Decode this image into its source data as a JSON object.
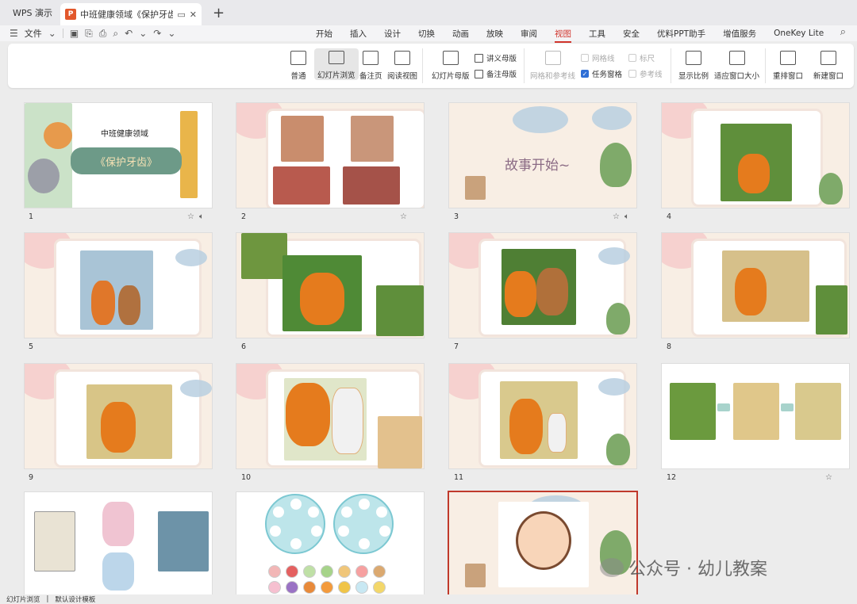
{
  "titlebar": {
    "app_label": "WPS 演示",
    "doc_tab_logo": "P",
    "doc_tab_title": "中班健康领域《保护牙齿》课",
    "new_tab_symbol": "+"
  },
  "menu": {
    "file_label": "文件",
    "tabs": [
      "开始",
      "插入",
      "设计",
      "切换",
      "动画",
      "放映",
      "审阅",
      "视图",
      "工具",
      "安全",
      "优料PPT助手",
      "增值服务",
      "OneKey Lite"
    ],
    "active_tab": "视图"
  },
  "ribbon": {
    "normal": "普通",
    "slide_browse": "幻灯片浏览",
    "notes_page": "备注页",
    "reading_view": "阅读视图",
    "slide_master": "幻灯片母版",
    "handout_master": "讲义母版",
    "notes_master": "备注母版",
    "grid_guides": "网格和参考线",
    "gridlines": "网格线",
    "task_pane": "任务窗格",
    "ruler": "标尺",
    "guides": "参考线",
    "zoom": "显示比例",
    "fit_window": "适应窗口大小",
    "arrange_window": "重排窗口",
    "new_window": "新建窗口"
  },
  "slides": {
    "n1": "1",
    "n2": "2",
    "n3": "3",
    "n4": "4",
    "n5": "5",
    "n6": "6",
    "n7": "7",
    "n8": "8",
    "n9": "9",
    "n10": "10",
    "n11": "11",
    "n12": "12",
    "s1_title": "中班健康领域",
    "s1_subtitle": "《保护牙齿》",
    "s3_text": "故事开始~"
  },
  "status": {
    "view": "幻灯片浏览",
    "design": "默认设计模板"
  },
  "watermark": "公众号 · 幼儿教案",
  "colors": {
    "accent": "#d0342c",
    "selected_border": "#c0392b",
    "ppt_logo": "#e2572b"
  }
}
